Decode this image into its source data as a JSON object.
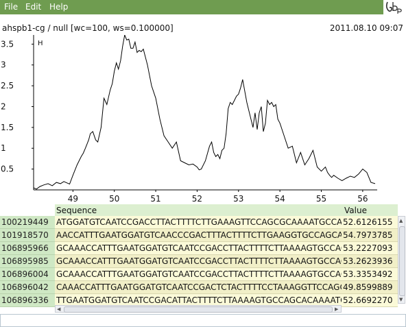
{
  "menu": {
    "file": "File",
    "edit": "Edit",
    "help": "Help"
  },
  "title": {
    "left": "ahspb1-cg / null [wc=100, ws=0.100000]",
    "right": "2011.08.10 09:07"
  },
  "colors": {
    "menubar": "#6f9c50",
    "header": "#dcefd0",
    "rowlabel": "#cfe8c4",
    "row": "#fbfad8"
  },
  "chart_data": {
    "type": "line",
    "title": "",
    "xlabel": "",
    "ylabel": "",
    "xlim": [
      48.05,
      56.35
    ],
    "ylim": [
      0,
      3.72
    ],
    "x_ticks": [
      "49",
      "50",
      "51",
      "52",
      "53",
      "54",
      "55",
      "56"
    ],
    "y_ticks": [
      "0.5",
      "1",
      "1.5",
      "2",
      "2.5",
      "3",
      "3.5"
    ],
    "marker": "H",
    "series": [
      {
        "x": [
          48.05,
          48.12,
          48.2,
          48.3,
          48.4,
          48.5,
          48.6,
          48.7,
          48.78,
          48.85,
          48.92,
          49.0,
          49.1,
          49.2,
          49.25,
          49.3,
          49.38,
          49.42,
          49.48,
          49.55,
          49.6,
          49.68,
          49.75,
          49.82,
          49.9,
          49.95,
          50.0,
          50.05,
          50.1,
          50.15,
          50.2,
          50.25,
          50.3,
          50.35,
          50.4,
          50.45,
          50.5,
          50.55,
          50.6,
          50.65,
          50.7,
          50.8,
          50.9,
          51.0,
          51.1,
          51.2,
          51.3,
          51.4,
          51.5,
          51.6,
          51.7,
          51.8,
          51.9,
          52.0,
          52.05,
          52.1,
          52.2,
          52.3,
          52.35,
          52.4,
          52.45,
          52.5,
          52.55,
          52.6,
          52.65,
          52.7,
          52.75,
          52.8,
          52.85,
          52.9,
          52.95,
          53.0,
          53.05,
          53.1,
          53.2,
          53.3,
          53.35,
          53.4,
          53.45,
          53.5,
          53.55,
          53.6,
          53.65,
          53.7,
          53.75,
          53.8,
          53.85,
          53.9,
          53.95,
          54.0,
          54.1,
          54.2,
          54.3,
          54.4,
          54.5,
          54.6,
          54.7,
          54.8,
          54.9,
          55.0,
          55.1,
          55.15,
          55.2,
          55.25,
          55.3,
          55.4,
          55.5,
          55.6,
          55.7,
          55.8,
          55.9,
          56.0,
          56.1,
          56.2,
          56.3
        ],
        "y": [
          0.05,
          0.02,
          0.08,
          0.12,
          0.15,
          0.1,
          0.18,
          0.15,
          0.2,
          0.17,
          0.14,
          0.35,
          0.6,
          0.8,
          0.88,
          1.0,
          1.2,
          1.35,
          1.4,
          1.2,
          1.15,
          1.5,
          2.2,
          2.05,
          2.4,
          2.55,
          2.85,
          3.05,
          2.9,
          3.1,
          3.45,
          3.72,
          3.6,
          3.62,
          3.4,
          3.4,
          3.55,
          3.3,
          3.35,
          3.32,
          3.38,
          3.0,
          2.5,
          2.2,
          1.7,
          1.3,
          1.15,
          1.0,
          1.15,
          0.7,
          0.65,
          0.6,
          0.62,
          0.55,
          0.48,
          0.5,
          0.7,
          1.05,
          1.15,
          0.9,
          0.8,
          0.85,
          0.75,
          0.95,
          1.0,
          1.35,
          1.95,
          2.1,
          2.05,
          2.15,
          2.25,
          2.3,
          2.45,
          2.65,
          2.1,
          1.7,
          1.5,
          1.85,
          1.45,
          1.85,
          2.0,
          1.4,
          1.6,
          2.15,
          2.05,
          2.1,
          2.0,
          2.05,
          1.7,
          1.6,
          1.3,
          1.0,
          1.05,
          0.65,
          0.9,
          0.6,
          0.75,
          0.95,
          0.55,
          0.45,
          0.55,
          0.42,
          0.35,
          0.3,
          0.35,
          0.28,
          0.22,
          0.28,
          0.33,
          0.3,
          0.38,
          0.5,
          0.42,
          0.18,
          0.15
        ]
      }
    ]
  },
  "table": {
    "header_sequence": "Sequence",
    "header_value": "Value",
    "rows": [
      {
        "id": "100219449",
        "seq": "ATGGATGTCAATCCGACCTTACTTTTCTTGAAAGTTCCAGCGCAAAATGCCAGC",
        "val": "52.6126155"
      },
      {
        "id": "101918570",
        "seq": "AACCATTTGAATGGATGTCAACCCGACTTTACTTTTCTTGAAGGTGCCAGCA",
        "val": "54.7973785"
      },
      {
        "id": "106895966",
        "seq": "GCAAACCATTTGAATGGATGTCAATCCGACCTTACTTTTCTTAAAAGTGCCAGC",
        "val": "53.2227093"
      },
      {
        "id": "106895985",
        "seq": "GCAAACCATTTGAATGGATGTCAATCCGACCTTACTTTTCTTAAAAGTGCCAGC",
        "val": "53.2623936"
      },
      {
        "id": "106896004",
        "seq": "GCAAACCATTTGAATGGATGTCAATCCGACCTTACTTTTCTTAAAAGTGCCAGC",
        "val": "53.3353492"
      },
      {
        "id": "106896042",
        "seq": "CAAACCATTTGAATGGATGTCAATCCGACTCTACTTTTCCTAAAGGTTCCAGCA",
        "val": "49.8599889"
      },
      {
        "id": "106896336",
        "seq": "TTGAATGGATGTCAATCCGACATTACTTTTCTTAAAAGTGCCAGCACAAAATGC",
        "val": "52.6692270"
      }
    ]
  }
}
